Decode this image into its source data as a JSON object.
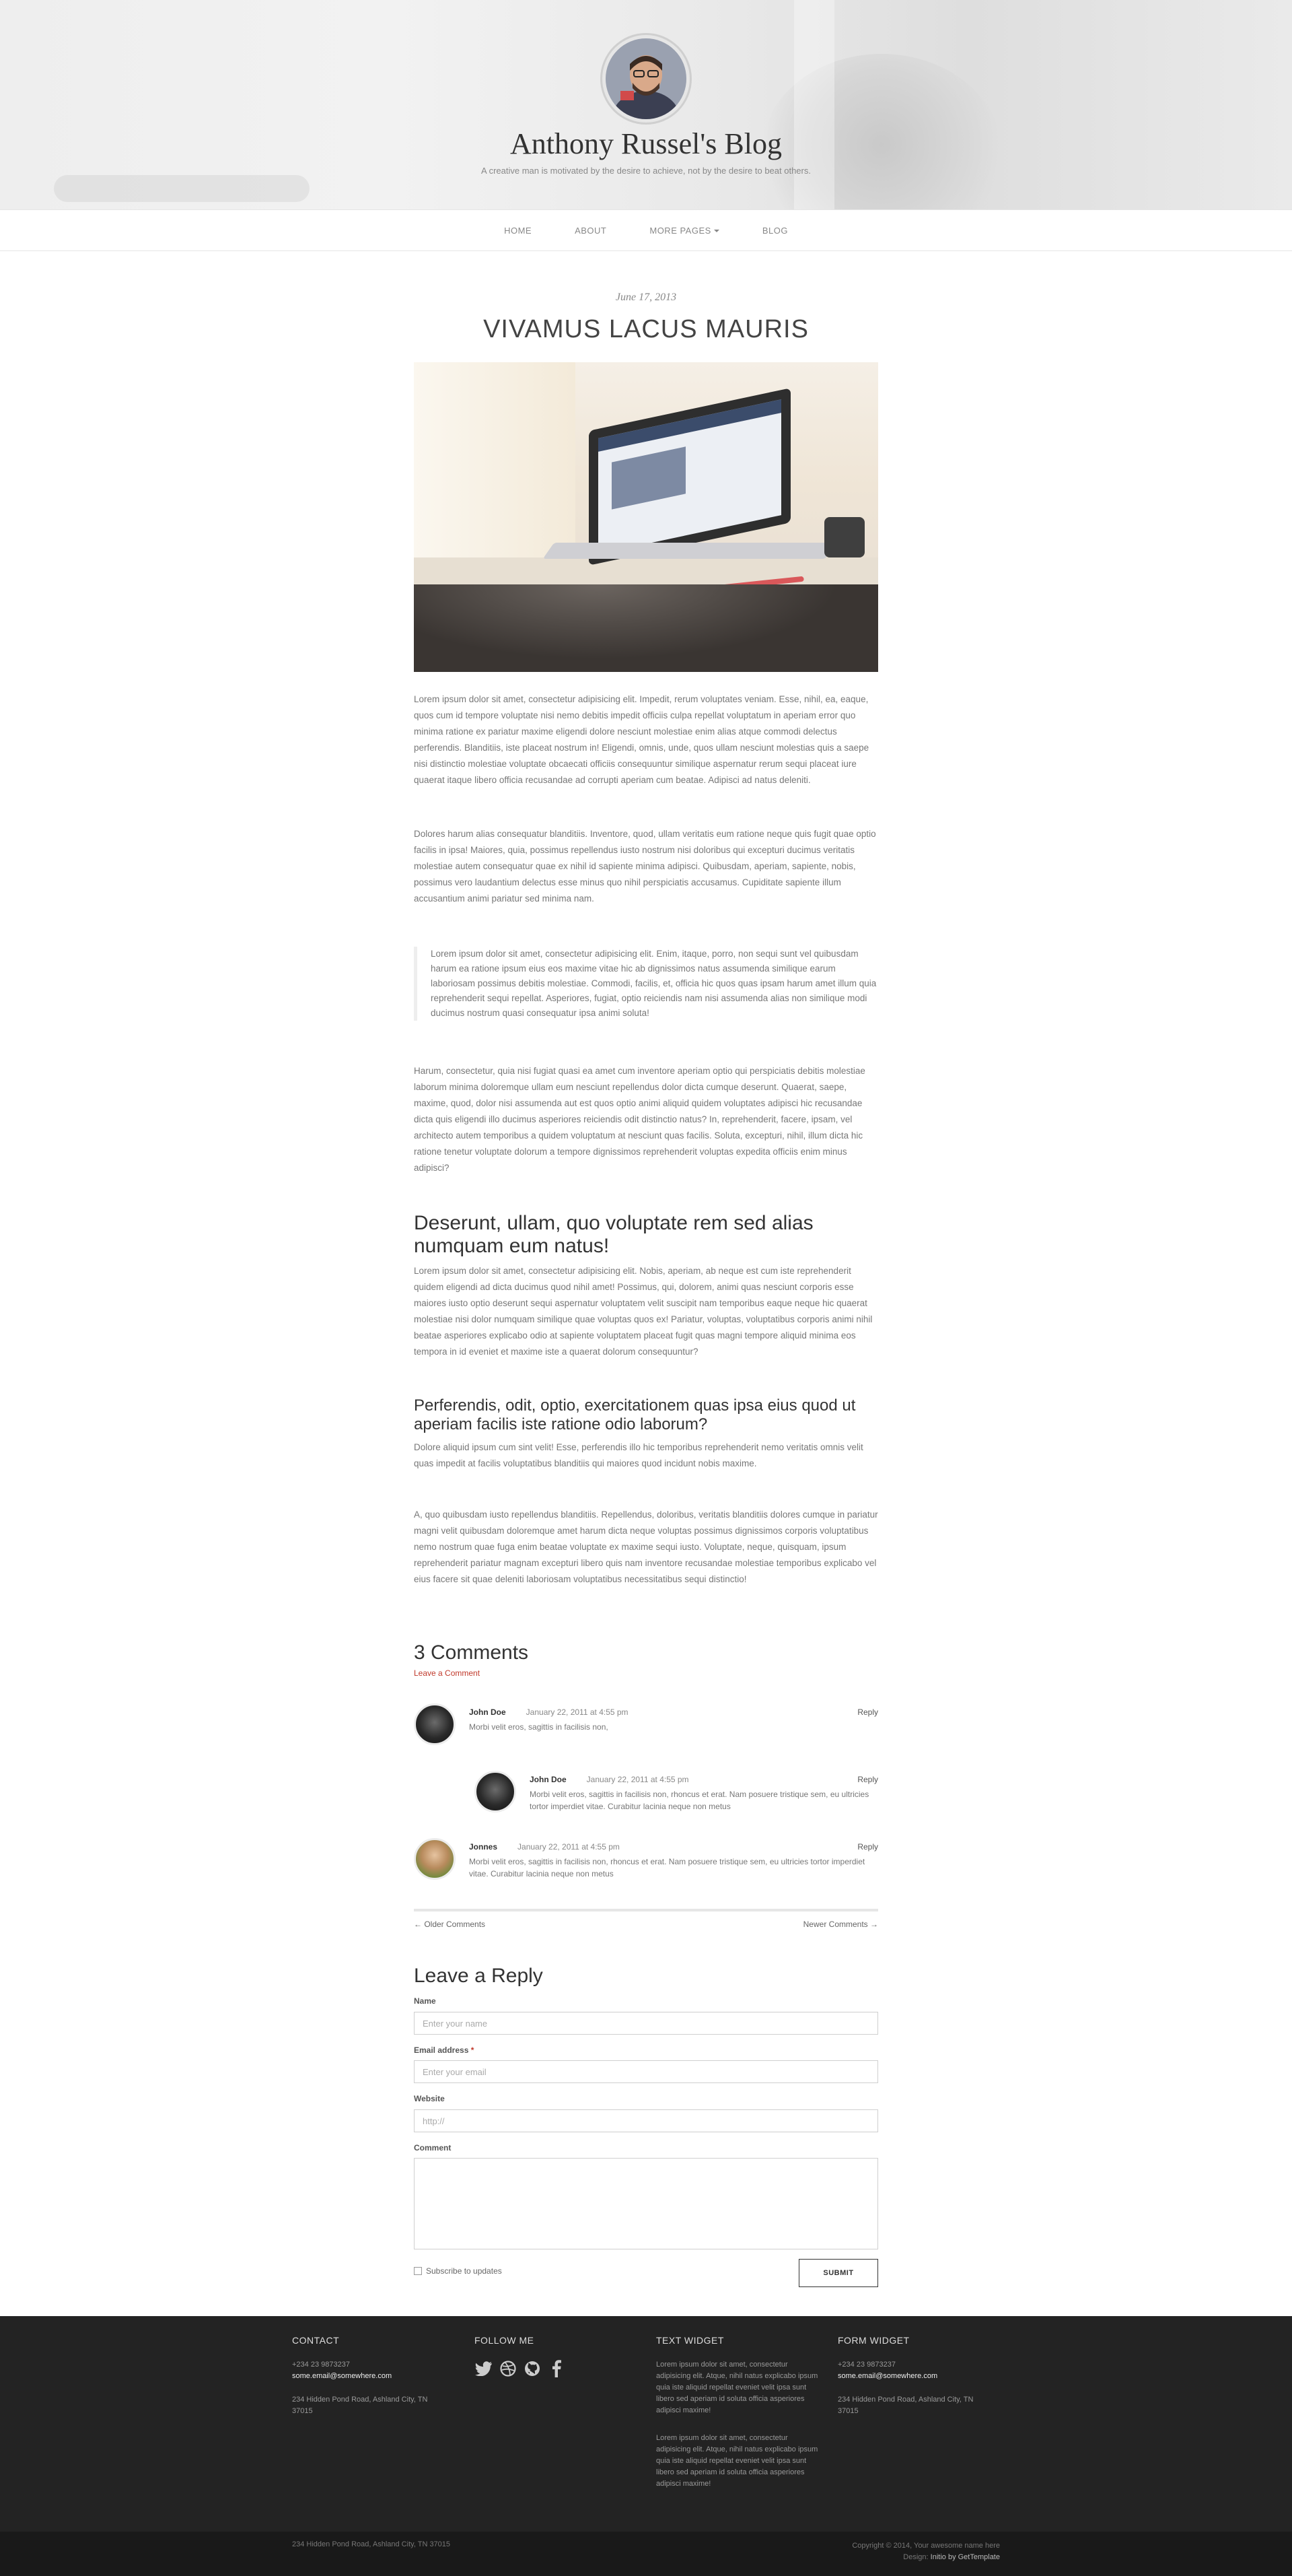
{
  "header": {
    "blog_title": "Anthony Russel's Blog",
    "tagline": "A creative man is motivated by the desire to achieve, not by the desire to beat others."
  },
  "nav": {
    "items": [
      "HOME",
      "ABOUT",
      "MORE PAGES",
      "BLOG"
    ]
  },
  "post": {
    "date": "June 17, 2013",
    "title": "VIVAMUS LACUS MAURIS",
    "paragraphs": [
      "Lorem ipsum dolor sit amet, consectetur adipisicing elit. Impedit, rerum voluptates veniam. Esse, nihil, ea, eaque, quos cum id tempore voluptate nisi nemo debitis impedit officiis culpa repellat voluptatum in aperiam error quo minima ratione ex pariatur maxime eligendi dolore nesciunt molestiae enim alias atque commodi delectus perferendis. Blanditiis, iste placeat nostrum in! Eligendi, omnis, unde, quos ullam nesciunt molestias quis a saepe nisi distinctio molestiae voluptate obcaecati officiis consequuntur similique aspernatur rerum sequi placeat iure quaerat itaque libero officia recusandae ad corrupti aperiam cum beatae. Adipisci ad natus deleniti.",
      "Dolores harum alias consequatur blanditiis. Inventore, quod, ullam veritatis eum ratione neque quis fugit quae optio facilis in ipsa! Maiores, quia, possimus repellendus iusto nostrum nisi doloribus qui excepturi ducimus veritatis molestiae autem consequatur quae ex nihil id sapiente minima adipisci. Quibusdam, aperiam, sapiente, nobis, possimus vero laudantium delectus esse minus quo nihil perspiciatis accusamus. Cupiditate sapiente illum accusantium animi pariatur sed minima nam.",
      "Harum, consectetur, quia nisi fugiat quasi ea amet cum inventore aperiam optio qui perspiciatis debitis molestiae laborum minima doloremque ullam eum nesciunt repellendus dolor dicta cumque deserunt. Quaerat, saepe, maxime, quod, dolor nisi assumenda aut est quos optio animi aliquid quidem voluptates adipisci hic recusandae dicta quis eligendi illo ducimus asperiores reiciendis odit distinctio natus? In, reprehenderit, facere, ipsam, vel architecto autem temporibus a quidem voluptatum at nesciunt quas facilis. Soluta, excepturi, nihil, illum dicta hic ratione tenetur voluptate dolorum a tempore dignissimos reprehenderit voluptas expedita officiis enim minus adipisci?",
      "Lorem ipsum dolor sit amet, consectetur adipisicing elit. Nobis, aperiam, ab neque est cum iste reprehenderit quidem eligendi ad dicta ducimus quod nihil amet! Possimus, qui, dolorem, animi quas nesciunt corporis esse maiores iusto optio deserunt sequi aspernatur voluptatem velit suscipit nam temporibus eaque neque hic quaerat molestiae nisi dolor numquam similique quae voluptas quos ex! Pariatur, voluptas, voluptatibus corporis animi nihil beatae asperiores explicabo odio at sapiente voluptatem placeat fugit quas magni tempore aliquid minima eos tempora in id eveniet et maxime iste a quaerat dolorum consequuntur?",
      "Dolore aliquid ipsum cum sint velit! Esse, perferendis illo hic temporibus reprehenderit nemo veritatis omnis velit quas impedit at facilis voluptatibus blanditiis qui maiores quod incidunt nobis maxime.",
      "A, quo quibusdam iusto repellendus blanditiis. Repellendus, doloribus, veritatis blanditiis dolores cumque in pariatur magni velit quibusdam doloremque amet harum dicta neque voluptas possimus dignissimos corporis voluptatibus nemo nostrum quae fuga enim beatae voluptate ex maxime sequi iusto. Voluptate, neque, quisquam, ipsum reprehenderit pariatur magnam excepturi libero quis nam inventore recusandae molestiae temporibus explicabo vel eius facere sit quae deleniti laboriosam voluptatibus necessitatibus sequi distinctio!"
    ],
    "blockquote": "Lorem ipsum dolor sit amet, consectetur adipisicing elit. Enim, itaque, porro, non sequi sunt vel quibusdam harum ea ratione ipsum eius eos maxime vitae hic ab dignissimos natus assumenda similique earum laboriosam possimus debitis molestiae. Commodi, facilis, et, officia hic quos quas ipsam harum amet illum quia reprehenderit sequi repellat. Asperiores, fugiat, optio reiciendis nam nisi assumenda alias non similique modi ducimus nostrum quasi consequatur ipsa animi soluta!",
    "heading1": "Deserunt, ullam, quo voluptate rem sed alias numquam eum natus!",
    "heading2": "Perferendis, odit, optio, exercitationem quas ipsa eius quod ut aperiam facilis iste ratione odio laborum?"
  },
  "comments": {
    "title": "3 Comments",
    "leave_link": "Leave a Comment",
    "items": [
      {
        "name": "John Doe",
        "date": "January 22, 2011 at 4:55 pm",
        "reply": "Reply",
        "text": "Morbi velit eros, sagittis in facilisis non,"
      },
      {
        "name": "John Doe",
        "date": "January 22, 2011 at 4:55 pm",
        "reply": "Reply",
        "text": "Morbi velit eros, sagittis in facilisis non, rhoncus et erat. Nam posuere tristique sem, eu ultricies tortor imperdiet vitae. Curabitur lacinia neque non metus"
      },
      {
        "name": "Jonnes",
        "date": "January 22, 2011 at 4:55 pm",
        "reply": "Reply",
        "text": "Morbi velit eros, sagittis in facilisis non, rhoncus et erat. Nam posuere tristique sem, eu ultricies tortor imperdiet vitae. Curabitur lacinia neque non metus"
      }
    ],
    "older": "← Older Comments",
    "newer": "Newer Comments →"
  },
  "reply_form": {
    "title": "Leave a Reply",
    "name_label": "Name",
    "name_placeholder": "Enter your name",
    "email_label": "Email address",
    "email_required": "*",
    "email_placeholder": "Enter your email",
    "website_label": "Website",
    "website_placeholder": "http://",
    "comment_label": "Comment",
    "subscribe_label": "Subscribe to updates",
    "submit_label": "SUBMIT"
  },
  "footer": {
    "contact": {
      "title": "CONTACT",
      "phone": "+234 23 9873237",
      "email": "some.email@somewhere.com",
      "address": "234 Hidden Pond Road, Ashland City, TN 37015"
    },
    "follow": {
      "title": "FOLLOW ME",
      "icons": [
        "twitter-icon",
        "dribbble-icon",
        "github-icon",
        "facebook-icon"
      ]
    },
    "text_widget": {
      "title": "TEXT WIDGET",
      "p1": "Lorem ipsum dolor sit amet, consectetur adipisicing elit. Atque, nihil natus explicabo ipsum quia iste aliquid repellat eveniet velit ipsa sunt libero sed aperiam id soluta officia asperiores adipisci maxime!",
      "p2": "Lorem ipsum dolor sit amet, consectetur adipisicing elit. Atque, nihil natus explicabo ipsum quia iste aliquid repellat eveniet velit ipsa sunt libero sed aperiam id soluta officia asperiores adipisci maxime!"
    },
    "form_widget": {
      "title": "FORM WIDGET",
      "phone": "+234 23 9873237",
      "email": "some.email@somewhere.com",
      "address": "234 Hidden Pond Road, Ashland City, TN 37015"
    },
    "bottom_left": "234 Hidden Pond Road, Ashland City, TN 37015",
    "copyright": "Copyright © 2014, Your awesome name here",
    "design_prefix": "Design:",
    "design_brand": "Initio by GetTemplate"
  }
}
